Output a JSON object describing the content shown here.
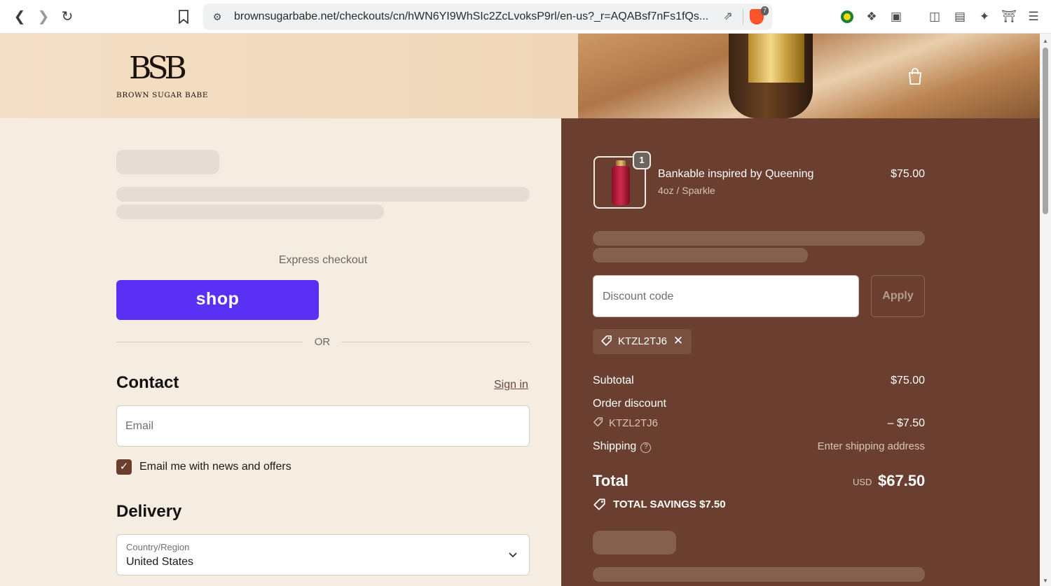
{
  "browser": {
    "url": "brownsugarbabe.net/checkouts/cn/hWN6YI9WhSIc2ZcLvoksP9rl/en-us?_r=AQABsf7nFs1fQs...",
    "shield_count": "7",
    "icons": [
      "back-icon",
      "forward-icon",
      "reload-icon",
      "bookmark-icon",
      "site-settings-icon",
      "share-icon",
      "brave-shield-icon",
      "extension-icon",
      "puzzle-icon",
      "reader-icon",
      "sidebar-icon",
      "wallet-icon",
      "leo-ai-icon",
      "vpn-icon",
      "menu-icon"
    ]
  },
  "header": {
    "logo_mark": "BSB",
    "logo_text": "BROWN SUGAR BABE"
  },
  "left": {
    "express_label": "Express checkout",
    "shop_label": "shop",
    "or_label": "OR",
    "contact_title": "Contact",
    "sign_in": "Sign in",
    "email_placeholder": "Email",
    "newsletter_label": "Email me with news and offers",
    "newsletter_checked": true,
    "delivery_title": "Delivery",
    "country_label": "Country/Region",
    "country_value": "United States"
  },
  "summary": {
    "item": {
      "name": "Bankable inspired by Queening",
      "variant": "4oz / Sparkle",
      "price": "$75.00",
      "quantity": "1"
    },
    "discount_placeholder": "Discount code",
    "apply_label": "Apply",
    "applied_code": "KTZL2TJ6",
    "subtotal_label": "Subtotal",
    "subtotal_value": "$75.00",
    "order_discount_label": "Order discount",
    "order_discount_code": "KTZL2TJ6",
    "order_discount_value": "– $7.50",
    "shipping_label": "Shipping",
    "shipping_value": "Enter shipping address",
    "total_label": "Total",
    "total_currency": "USD",
    "total_value": "$67.50",
    "savings_label": "TOTAL SAVINGS  $7.50"
  },
  "colors": {
    "shop_pay": "#5a31f4",
    "summary_bg": "#6a3f2f",
    "page_bg": "#f5ece2",
    "checkbox": "#6b3e2e"
  }
}
